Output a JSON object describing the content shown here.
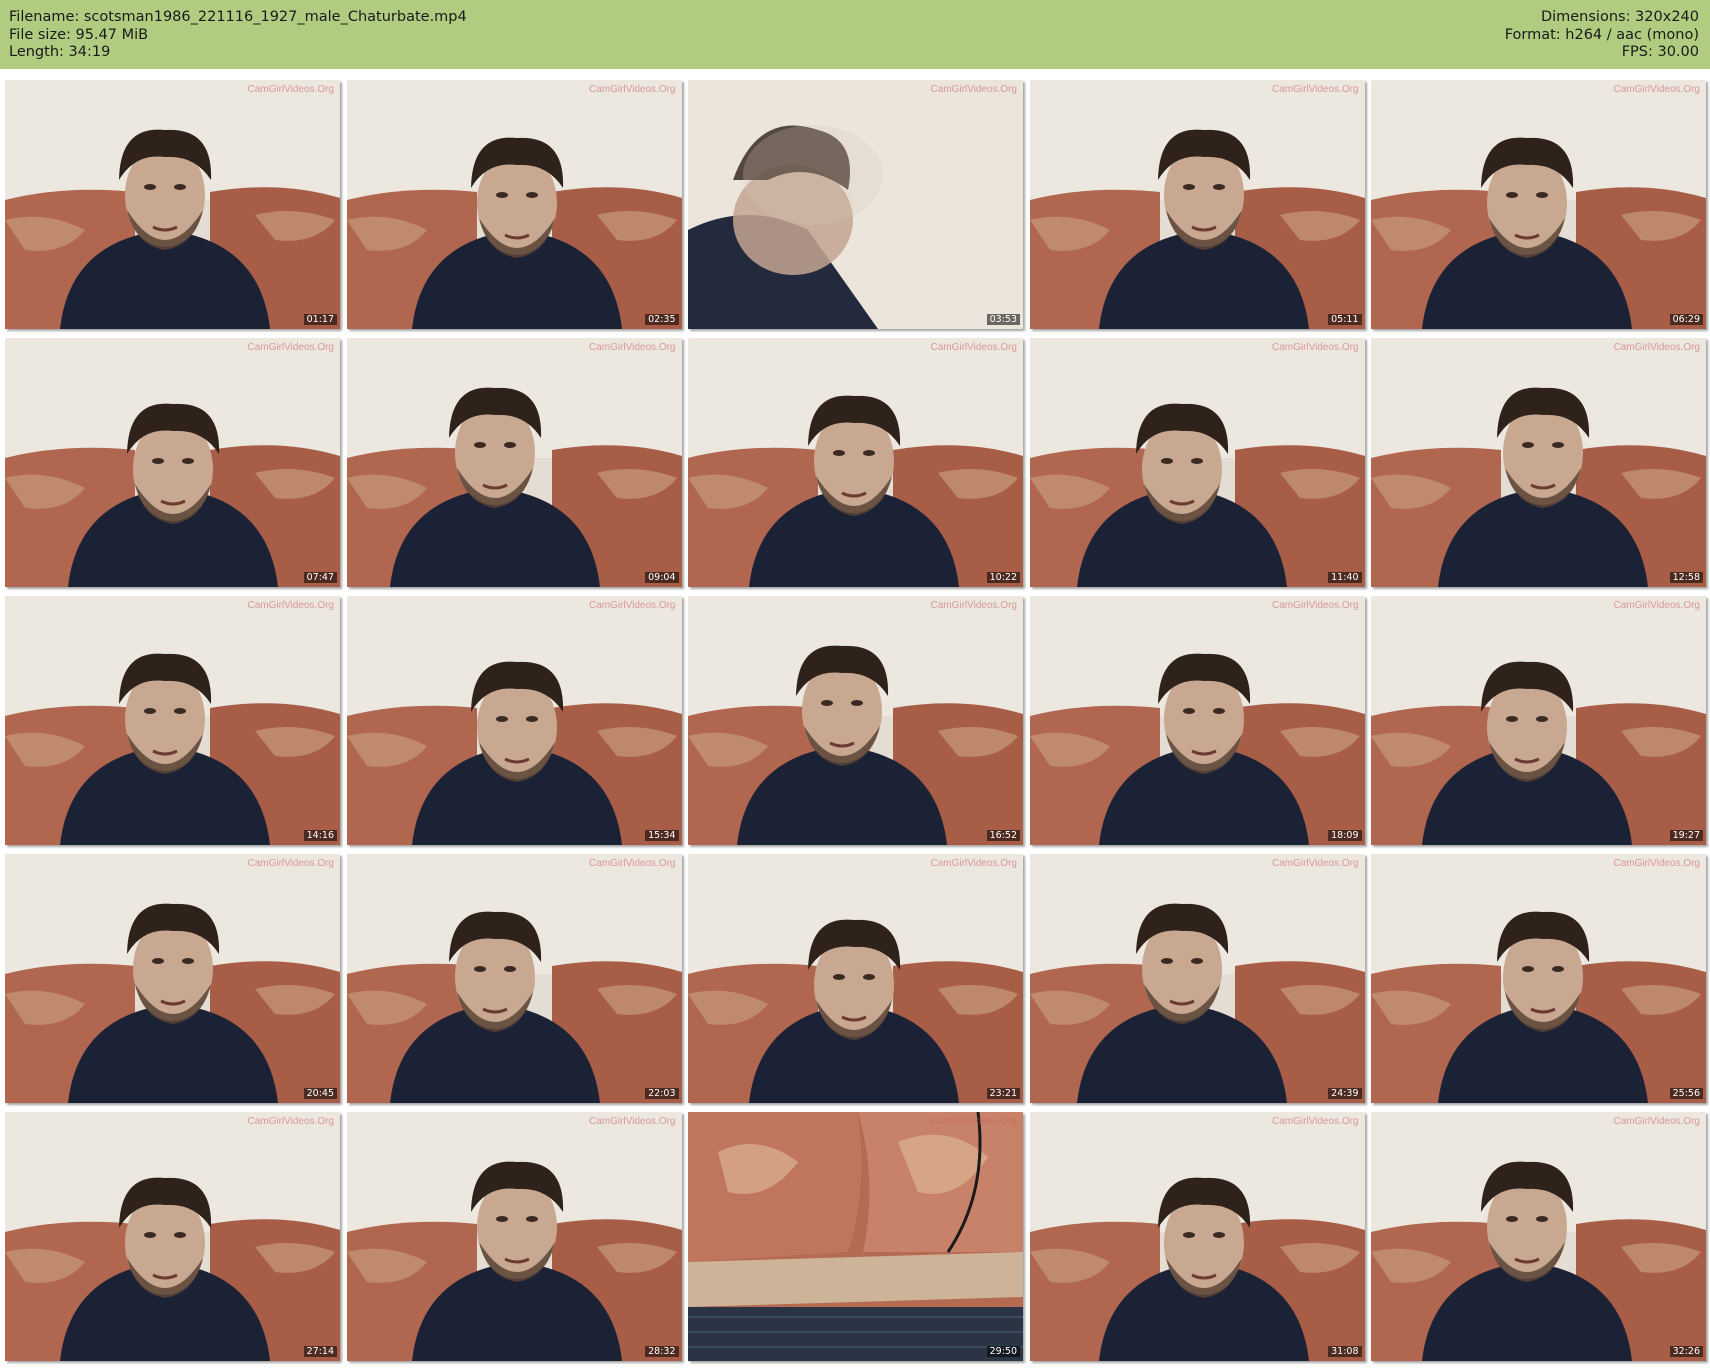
{
  "header": {
    "filename": "Filename: scotsman1986_221116_1927_male_Chaturbate.mp4",
    "filesize": "File size: 95.47 MiB",
    "length": "Length: 34:19",
    "dimensions": "Dimensions: 320x240",
    "format": "Format: h264 / aac (mono)",
    "fps": "FPS: 30.00"
  },
  "watermark": "CamGirlVideos.Org",
  "thumbnails": [
    {
      "time": "01:17",
      "kind": "person"
    },
    {
      "time": "02:35",
      "kind": "person"
    },
    {
      "time": "03:53",
      "kind": "blur"
    },
    {
      "time": "05:11",
      "kind": "person"
    },
    {
      "time": "06:29",
      "kind": "person"
    },
    {
      "time": "07:47",
      "kind": "person"
    },
    {
      "time": "09:04",
      "kind": "person"
    },
    {
      "time": "10:22",
      "kind": "person"
    },
    {
      "time": "11:40",
      "kind": "person"
    },
    {
      "time": "12:58",
      "kind": "person"
    },
    {
      "time": "14:16",
      "kind": "person"
    },
    {
      "time": "15:34",
      "kind": "person"
    },
    {
      "time": "16:52",
      "kind": "person"
    },
    {
      "time": "18:09",
      "kind": "person"
    },
    {
      "time": "19:27",
      "kind": "person"
    },
    {
      "time": "20:45",
      "kind": "person"
    },
    {
      "time": "22:03",
      "kind": "person"
    },
    {
      "time": "23:21",
      "kind": "person"
    },
    {
      "time": "24:39",
      "kind": "person"
    },
    {
      "time": "25:56",
      "kind": "person"
    },
    {
      "time": "27:14",
      "kind": "person"
    },
    {
      "time": "28:32",
      "kind": "person"
    },
    {
      "time": "29:50",
      "kind": "sofa"
    },
    {
      "time": "31:08",
      "kind": "person"
    },
    {
      "time": "32:26",
      "kind": "person"
    }
  ]
}
